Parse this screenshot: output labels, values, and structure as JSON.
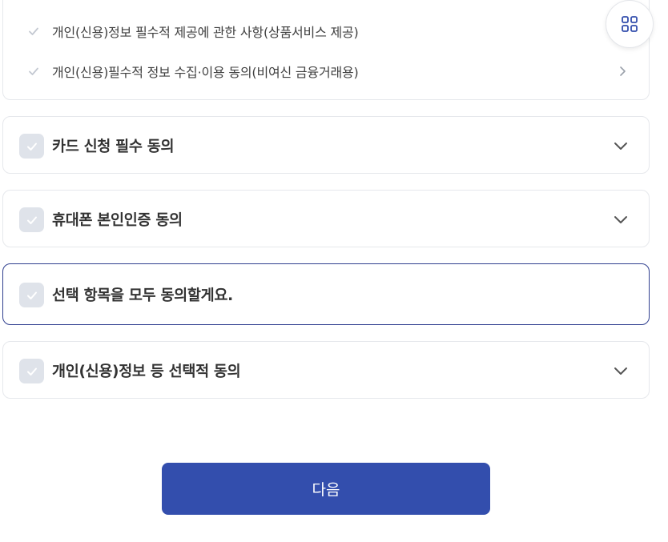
{
  "required_items": [
    {
      "label": "개인(신용)정보 필수적 제공에 관한 사항(상품서비스 제공)"
    },
    {
      "label": "개인(신용)필수적 정보 수집·이용 동의(비여신 금융거래용)"
    }
  ],
  "sections": [
    {
      "title": "카드 신청 필수 동의",
      "expandable": true
    },
    {
      "title": "휴대폰 본인인증 동의",
      "expandable": true
    },
    {
      "title": "선택 항목을 모두 동의할게요.",
      "expandable": false
    },
    {
      "title": "개인(신용)정보 등 선택적 동의",
      "expandable": true
    }
  ],
  "next_button": {
    "label": "다음"
  },
  "colors": {
    "primary": "#334ead",
    "checkbox_bg": "#dfe3ea",
    "selected_border": "#2f3f8f",
    "card_border": "#e6e8ec"
  },
  "icons": {
    "fab": "grid-menu-icon",
    "expand": "chevron-down-icon",
    "detail": "chevron-right-icon",
    "check": "check-icon"
  }
}
